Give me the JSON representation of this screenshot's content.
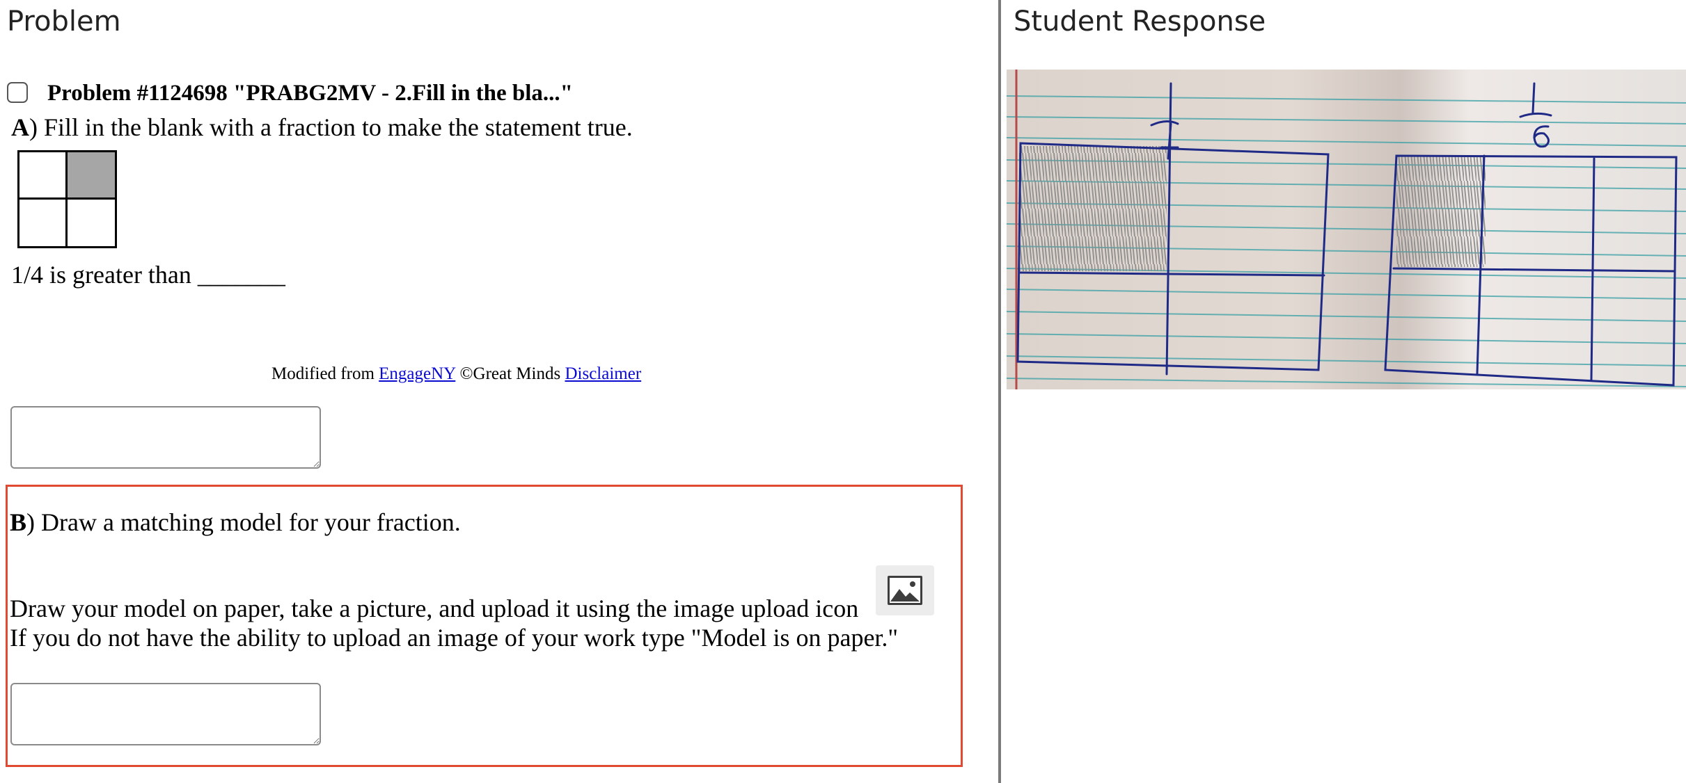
{
  "panes": {
    "problem_title": "Problem",
    "response_title": "Student Response"
  },
  "problem": {
    "title": "Problem #1124698 \"PRABG2MV - 2.Fill in the bla...\"",
    "part_a": {
      "label": "A",
      "text": ") Fill in the blank with a fraction to make the statement true.",
      "model": {
        "rows": 2,
        "cols": 2,
        "shaded_cells": [
          1
        ]
      },
      "statement": "1/4 is greater than _______",
      "credit_prefix": "Modified from ",
      "credit_link": "EngageNY",
      "credit_middle": " ©Great Minds ",
      "credit_disclaimer": "Disclaimer",
      "answer_value": ""
    },
    "part_b": {
      "label": "B",
      "text": ") Draw a matching model for your fraction.",
      "instruction_1": "Draw your model on paper, take a picture, and upload it using the image upload icon",
      "instruction_2": "If you do not have the ability to upload an image of your work type \"Model is on paper.\"",
      "upload_icon": "image-icon",
      "answer_value": ""
    }
  },
  "colors": {
    "highlight_border": "#e04a32",
    "link": "#0a0ad0",
    "shaded_cell": "#a6a6a6"
  }
}
